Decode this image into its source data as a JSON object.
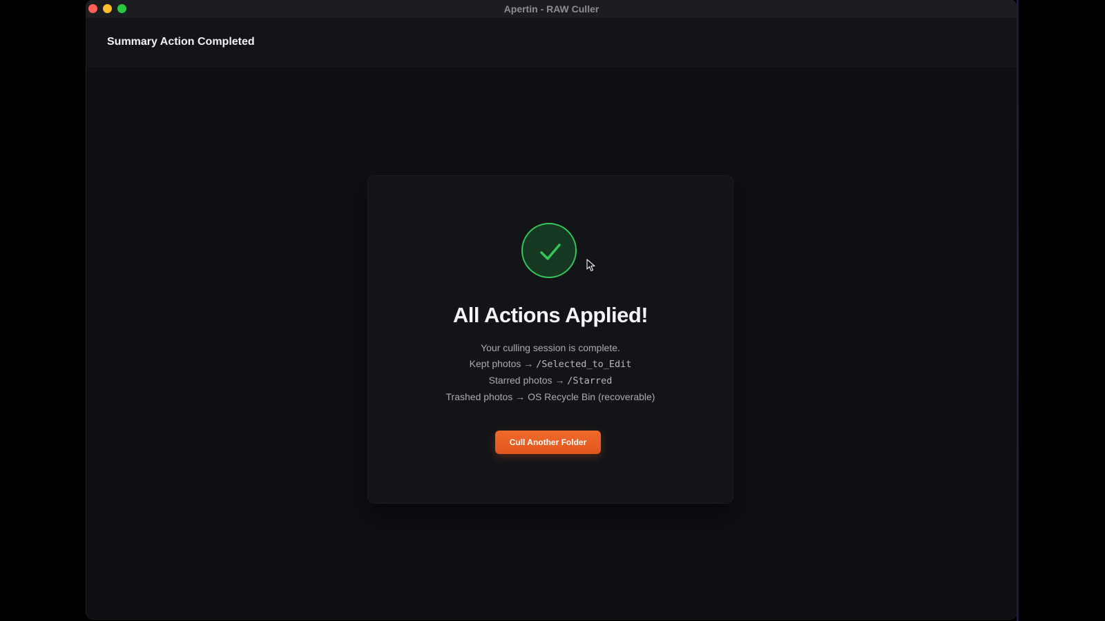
{
  "window": {
    "title": "Apertin - RAW Culler"
  },
  "header": {
    "title": "Summary Action Completed"
  },
  "card": {
    "icon": "checkmark-icon",
    "title": "All Actions Applied!",
    "session_text": "Your culling session is complete.",
    "kept": {
      "label": "Kept photos",
      "arrow": "→",
      "path": "/Selected_to_Edit"
    },
    "starred": {
      "label": "Starred photos",
      "arrow": "→",
      "path": "/Starred"
    },
    "trashed": {
      "label": "Trashed photos",
      "arrow": "→",
      "destination": "OS Recycle Bin (recoverable)"
    },
    "button_label": "Cull Another Folder"
  },
  "colors": {
    "accent": "#f06a2c",
    "success": "#34c759",
    "background": "#0e1014",
    "card": "#131418"
  }
}
